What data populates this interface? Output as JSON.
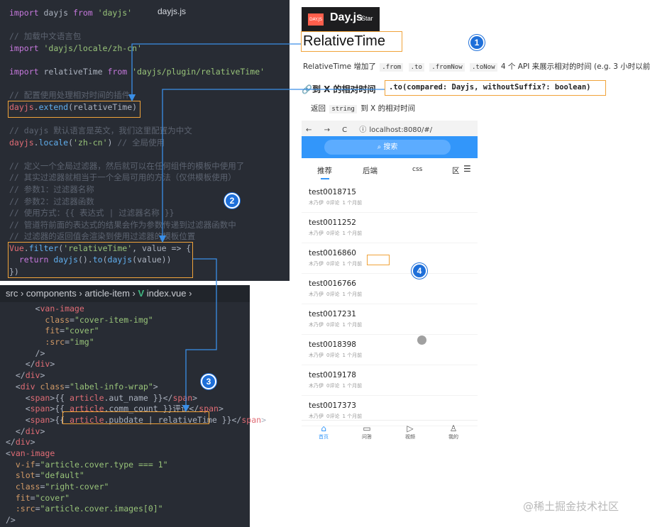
{
  "code_top": {
    "tab_name": "dayjs.js",
    "lines": [
      [
        [
          "kw",
          "import "
        ],
        [
          "pl",
          "dayjs "
        ],
        [
          "kw",
          "from "
        ],
        [
          "str",
          "'dayjs'"
        ]
      ],
      [],
      [
        [
          "cm",
          "// 加载中文语言包"
        ]
      ],
      [
        [
          "kw",
          "import "
        ],
        [
          "str",
          "'dayjs/locale/zh-cn'"
        ]
      ],
      [],
      [
        [
          "kw",
          "import "
        ],
        [
          "pl",
          "relativeTime "
        ],
        [
          "kw",
          "from "
        ],
        [
          "str",
          "'dayjs/plugin/relativeTime'"
        ]
      ],
      [],
      [
        [
          "cm",
          "// 配置使用处理相对时间的插件"
        ]
      ],
      [
        [
          "id",
          "dayjs"
        ],
        [
          "pl",
          "."
        ],
        [
          "fn",
          "extend"
        ],
        [
          "pl",
          "(relativeTime)"
        ]
      ],
      [],
      [
        [
          "cm",
          "// dayjs 默认语言是英文，我们这里配置为中文"
        ]
      ],
      [
        [
          "id",
          "dayjs"
        ],
        [
          "pl",
          "."
        ],
        [
          "fn",
          "locale"
        ],
        [
          "pl",
          "("
        ],
        [
          "str",
          "'zh-cn'"
        ],
        [
          "pl",
          ") "
        ],
        [
          "cm",
          "// 全局使用"
        ]
      ],
      [],
      [
        [
          "cm",
          "// 定义一个全局过滤器，然后就可以在任何组件的模板中使用了"
        ]
      ],
      [
        [
          "cm",
          "// 其实过滤器就相当于一个全局可用的方法（仅供模板使用）"
        ]
      ],
      [
        [
          "cm",
          "// 参数1：过滤器名称"
        ]
      ],
      [
        [
          "cm",
          "// 参数2：过滤器函数"
        ]
      ],
      [
        [
          "cm",
          "// 使用方式：{{ 表达式 | 过滤器名称 }}"
        ]
      ],
      [
        [
          "cm",
          "// 管道符前面的表达式的结果会作为参数传递到过滤器函数中"
        ]
      ],
      [
        [
          "cm",
          "// 过滤器的返回值会渲染到使用过滤器的模板位置"
        ]
      ],
      [
        [
          "id",
          "Vue"
        ],
        [
          "pl",
          "."
        ],
        [
          "fn",
          "filter"
        ],
        [
          "pl",
          "("
        ],
        [
          "str",
          "'relativeTime'"
        ],
        [
          "pl",
          ", value => {"
        ]
      ],
      [
        [
          "kw",
          "  return "
        ],
        [
          "fn",
          "dayjs"
        ],
        [
          "pl",
          "()."
        ],
        [
          "fn",
          "to"
        ],
        [
          "pl",
          "("
        ],
        [
          "fn",
          "dayjs"
        ],
        [
          "pl",
          "(value))"
        ]
      ],
      [
        [
          "pl",
          "})"
        ]
      ]
    ]
  },
  "code_bottom": {
    "breadcrumb": [
      "src",
      "components",
      "article-item",
      "index.vue"
    ],
    "lines": [
      [
        [
          "pl",
          "      <"
        ],
        [
          "id",
          "van-image"
        ]
      ],
      [
        [
          "pl",
          "        "
        ],
        [
          "at",
          "class"
        ],
        [
          "pl",
          "="
        ],
        [
          "str",
          "\"cover-item-img\""
        ]
      ],
      [
        [
          "pl",
          "        "
        ],
        [
          "at",
          "fit"
        ],
        [
          "pl",
          "="
        ],
        [
          "str",
          "\"cover\""
        ]
      ],
      [
        [
          "pl",
          "        "
        ],
        [
          "at",
          ":src"
        ],
        [
          "pl",
          "="
        ],
        [
          "str",
          "\"img\""
        ]
      ],
      [
        [
          "pl",
          "      />"
        ]
      ],
      [
        [
          "pl",
          "    </"
        ],
        [
          "id",
          "div"
        ],
        [
          "pl",
          ">"
        ]
      ],
      [
        [
          "pl",
          "  </"
        ],
        [
          "id",
          "div"
        ],
        [
          "pl",
          ">"
        ]
      ],
      [
        [
          "pl",
          "  <"
        ],
        [
          "id",
          "div "
        ],
        [
          "at",
          "class"
        ],
        [
          "pl",
          "="
        ],
        [
          "str",
          "\"label-info-wrap\""
        ],
        [
          "pl",
          ">"
        ]
      ],
      [
        [
          "pl",
          "    <"
        ],
        [
          "id",
          "span"
        ],
        [
          "pl",
          ">{{ "
        ],
        [
          "id",
          "article"
        ],
        [
          "pl",
          ".aut_name }}</"
        ],
        [
          "id",
          "span"
        ],
        [
          "pl",
          ">"
        ]
      ],
      [
        [
          "pl",
          "    <"
        ],
        [
          "id",
          "span"
        ],
        [
          "pl",
          ">{{ "
        ],
        [
          "id",
          "article"
        ],
        [
          "pl",
          ".comm_count }}评论</"
        ],
        [
          "id",
          "span"
        ],
        [
          "pl",
          ">"
        ]
      ],
      [
        [
          "pl",
          "    <"
        ],
        [
          "id",
          "span"
        ],
        [
          "pl",
          ">{{ "
        ],
        [
          "id",
          "article"
        ],
        [
          "pl",
          ".pubdate | relativeTime }}</"
        ],
        [
          "id",
          "span"
        ],
        [
          "pl",
          ">"
        ]
      ],
      [
        [
          "pl",
          "  </"
        ],
        [
          "id",
          "div"
        ],
        [
          "pl",
          ">"
        ]
      ],
      [
        [
          "pl",
          "</"
        ],
        [
          "id",
          "div"
        ],
        [
          "pl",
          ">"
        ]
      ],
      [
        [
          "pl",
          "<"
        ],
        [
          "id",
          "van-image"
        ]
      ],
      [
        [
          "pl",
          "  "
        ],
        [
          "at",
          "v-if"
        ],
        [
          "pl",
          "="
        ],
        [
          "str",
          "\"article.cover.type === 1\""
        ]
      ],
      [
        [
          "pl",
          "  "
        ],
        [
          "at",
          "slot"
        ],
        [
          "pl",
          "="
        ],
        [
          "str",
          "\"default\""
        ]
      ],
      [
        [
          "pl",
          "  "
        ],
        [
          "at",
          "class"
        ],
        [
          "pl",
          "="
        ],
        [
          "str",
          "\"right-cover\""
        ]
      ],
      [
        [
          "pl",
          "  "
        ],
        [
          "at",
          "fit"
        ],
        [
          "pl",
          "="
        ],
        [
          "str",
          "\"cover\""
        ]
      ],
      [
        [
          "pl",
          "  "
        ],
        [
          "at",
          ":src"
        ],
        [
          "pl",
          "="
        ],
        [
          "str",
          "\"article.cover.images[0]\""
        ]
      ],
      [
        [
          "pl",
          "/>"
        ]
      ]
    ]
  },
  "doc": {
    "logo_icon_text": "DAY.JS",
    "logo_name": "Day.js",
    "logo_star": "Star",
    "heading": "RelativeTime",
    "desc_before": "RelativeTime 增加了",
    "api_chips": [
      ".from",
      ".to",
      ".fromNow",
      ".toNow"
    ],
    "desc_after": "4 个 API 来展示相对的时间 (e.g. 3 小时以前).",
    "subheading": "🔗到 X 的相对时间",
    "signature": ".to(compared: Dayjs, withoutSuffix?: boolean)",
    "return_prefix": "返回",
    "return_chip": "string",
    "return_suffix": "到 X 的相对时间"
  },
  "browser": {
    "back": "←",
    "forward": "→",
    "reload": "C",
    "url": "localhost:8080/#/",
    "search_label": "搜索",
    "tabs": [
      "推荐",
      "后端",
      "css",
      "区"
    ],
    "articles": [
      {
        "title": "test0018715",
        "author": "木乃伊",
        "comments": "0评论",
        "time": "1 个月前"
      },
      {
        "title": "test0011252",
        "author": "木乃伊",
        "comments": "0评论",
        "time": "1 个月前"
      },
      {
        "title": "test0016860",
        "author": "木乃伊",
        "comments": "0评论",
        "time": "1 个月前"
      },
      {
        "title": "test0016766",
        "author": "木乃伊",
        "comments": "0评论",
        "time": "1 个月前"
      },
      {
        "title": "test0017231",
        "author": "木乃伊",
        "comments": "0评论",
        "time": "1 个月前"
      },
      {
        "title": "test0018398",
        "author": "木乃伊",
        "comments": "0评论",
        "time": "1 个月前"
      },
      {
        "title": "test0019178",
        "author": "木乃伊",
        "comments": "0评论",
        "time": "1 个月前"
      },
      {
        "title": "test0017373",
        "author": "木乃伊",
        "comments": "0评论",
        "time": "1 个月前"
      }
    ],
    "bottom_nav": [
      "首页",
      "问答",
      "视频",
      "我的"
    ]
  },
  "badges": [
    "1",
    "2",
    "3",
    "4"
  ],
  "watermark": "@稀土掘金技术社区",
  "colors": {
    "accent": "#3296fa",
    "highlight": "#f0a33a",
    "badge": "#1e6fd9",
    "arrow": "#3a8ee6"
  }
}
